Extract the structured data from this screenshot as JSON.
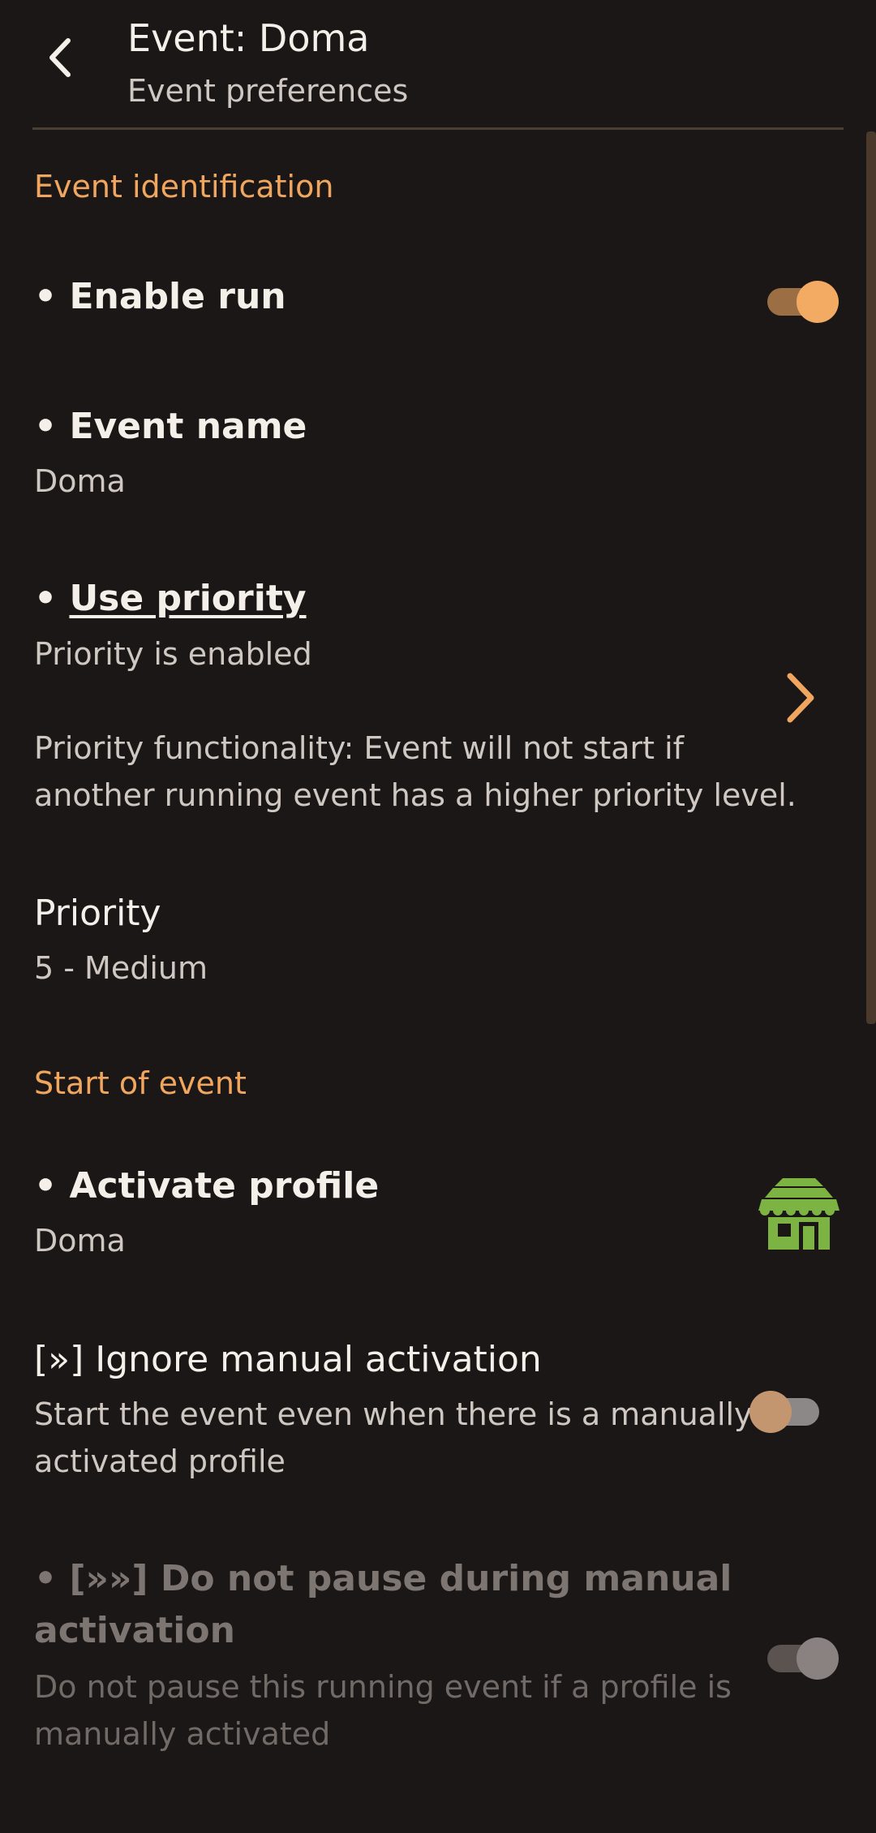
{
  "header": {
    "back_icon": "arrow-back-icon",
    "title": "Event: Doma",
    "subtitle": "Event preferences"
  },
  "sections": {
    "identification": "Event identification",
    "start": "Start of event"
  },
  "enable_run": {
    "title": "• Enable run",
    "checked": true
  },
  "event_name": {
    "title": "• Event name",
    "value": "Doma"
  },
  "use_priority": {
    "title_prefix": "• ",
    "title": "Use priority",
    "summary": "Priority is enabled",
    "description_line1": "Priority functionality: Event will not start if",
    "description_line2": "another running event has a higher priority level.",
    "chevron_icon": "chevron-right-icon"
  },
  "priority": {
    "title": "Priority",
    "value": "5 - Medium"
  },
  "activate_profile": {
    "title": "• Activate profile",
    "value": "Doma",
    "icon": "house-icon",
    "icon_color": "#7cb342"
  },
  "ignore_manual": {
    "title": "[»] Ignore manual activation",
    "summary_line1": "Start the event even when there is a manually",
    "summary_line2": "activated profile",
    "checked": false
  },
  "no_pause": {
    "title_line1": "• [»»] Do not pause during manual",
    "title_line2": "activation",
    "summary_line1": "Do not pause this running event if a profile is",
    "summary_line2": "manually activated",
    "checked": true,
    "enabled": false
  },
  "colors": {
    "accent": "#f0a65f",
    "background": "#1b1716"
  }
}
